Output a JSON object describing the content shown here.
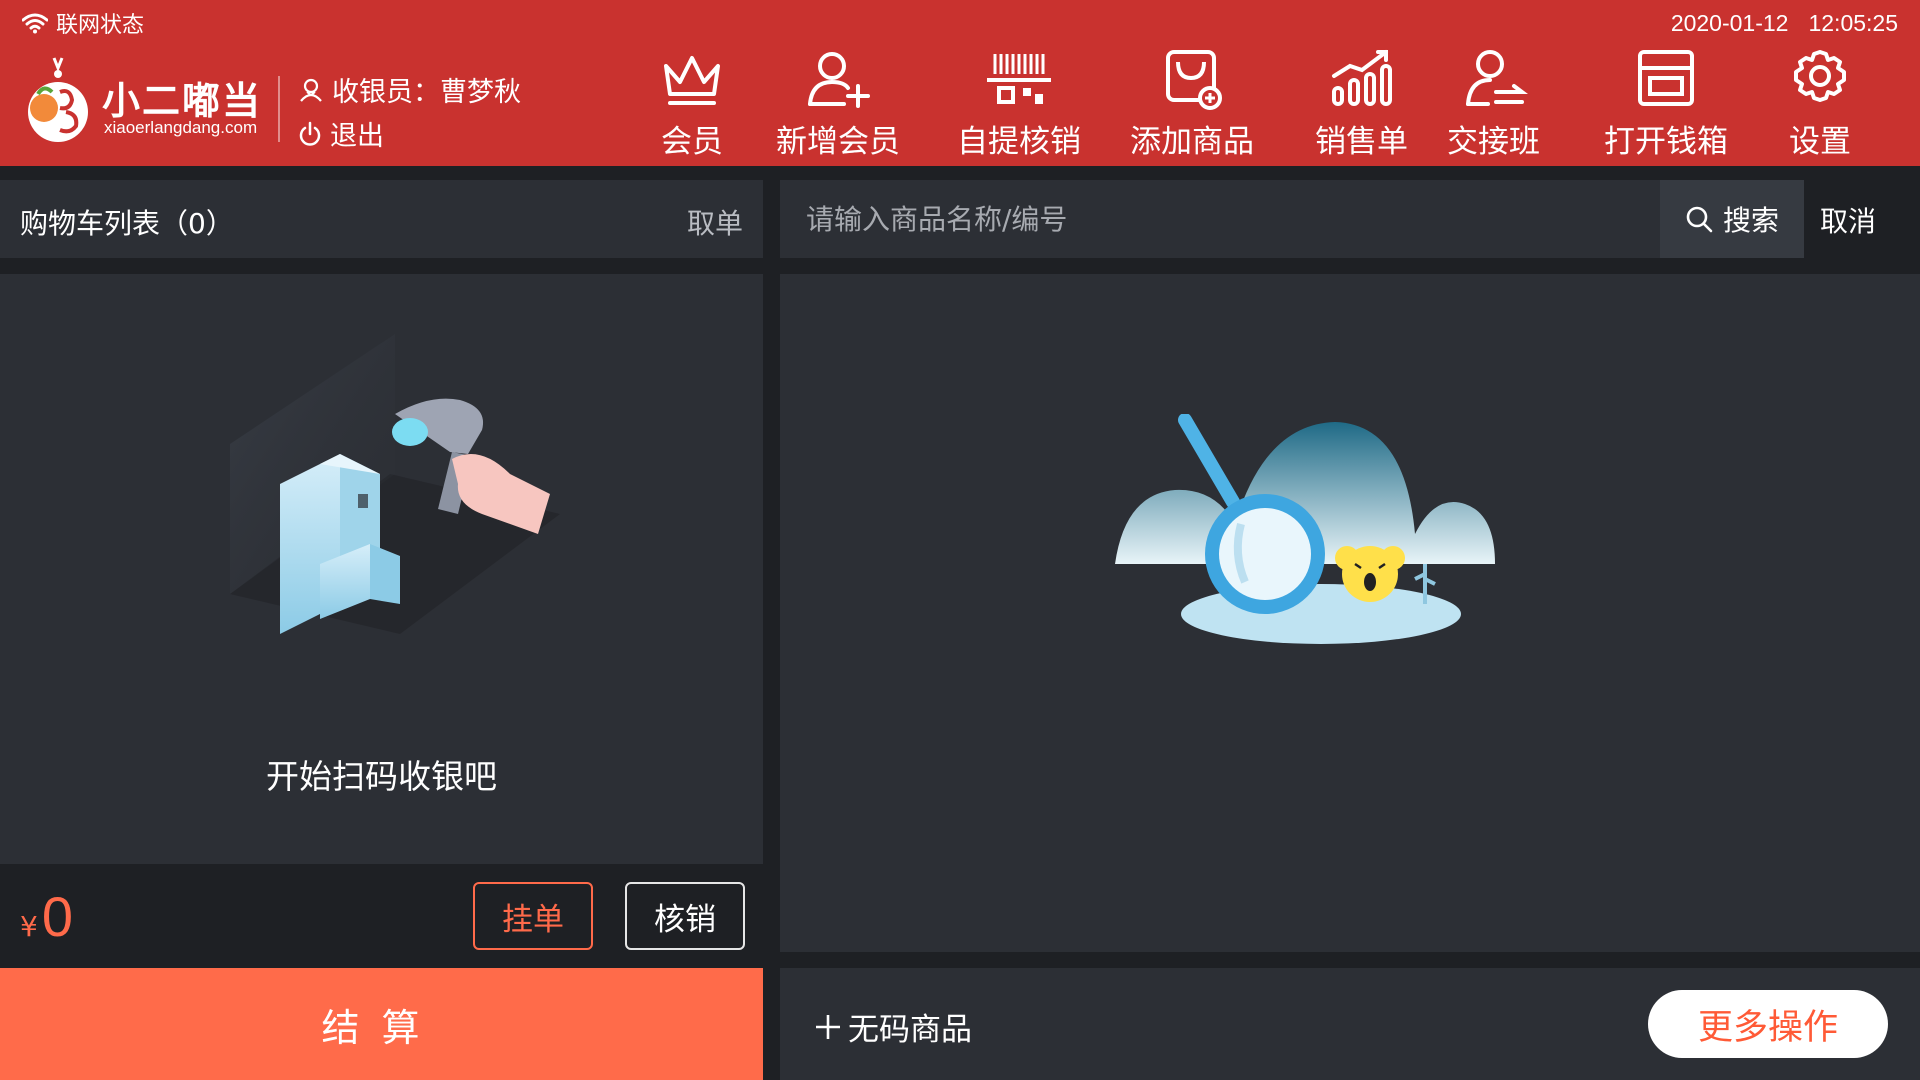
{
  "status_bar": {
    "network_label": "联网状态",
    "date": "2020-01-12",
    "time": "12:05:25"
  },
  "brand": {
    "name": "小二嘟当",
    "url": "xiaoerlangdang.com"
  },
  "cashier": {
    "label": "收银员：曹梦秋",
    "logout_label": "退出"
  },
  "nav": {
    "member": "会员",
    "new_member": "新增会员",
    "self_pickup": "自提核销",
    "add_product": "添加商品",
    "sales_order": "销售单",
    "shift_handover": "交接班",
    "open_cash_drawer": "打开钱箱",
    "settings": "设置"
  },
  "cart": {
    "title": "购物车列表（0）",
    "cancel_order": "取单",
    "empty_text": "开始扫码收银吧",
    "currency_symbol": "¥",
    "total": "0",
    "hold_order": "挂单",
    "verify": "核销",
    "checkout": "结算"
  },
  "search": {
    "placeholder": "请输入商品名称/编号",
    "button": "搜索",
    "cancel": "取消"
  },
  "footer": {
    "no_code_product": "无码商品",
    "more_operations": "更多操作"
  },
  "colors": {
    "header_red": "#c9322f",
    "accent_orange": "#ff6b4a",
    "panel_bg": "#2c2f35",
    "page_bg": "#1e2024"
  }
}
